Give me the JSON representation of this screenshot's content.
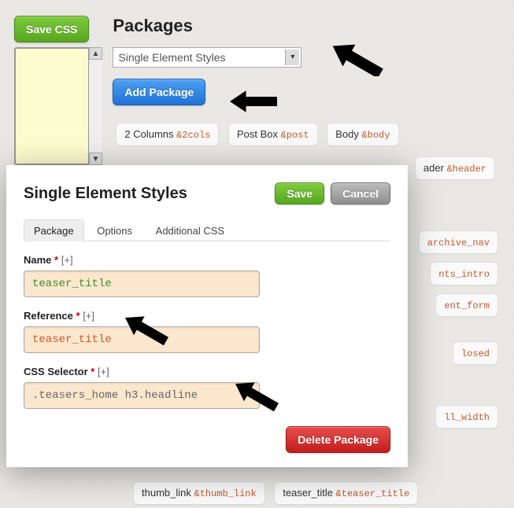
{
  "header": {
    "save_css_label": "Save CSS",
    "title": "Packages"
  },
  "package_select": {
    "selected": "Single Element Styles"
  },
  "add_package_label": "Add Package",
  "tags_row1": [
    {
      "label": "2 Columns",
      "ref": "&2cols"
    },
    {
      "label": "Post Box",
      "ref": "&post"
    },
    {
      "label": "Body",
      "ref": "&body"
    }
  ],
  "tag_header": {
    "label_suffix": "ader",
    "ref": "&header"
  },
  "right_tags": [
    {
      "ref": "archive_nav"
    },
    {
      "ref": "nts_intro"
    },
    {
      "ref": "ent_form"
    },
    {
      "ref": "losed"
    },
    {
      "ref": "ll_width"
    }
  ],
  "bottom_tags": [
    {
      "label": "thumb_link",
      "ref": "&thumb_link"
    },
    {
      "label": "teaser_title",
      "ref": "&teaser_title"
    }
  ],
  "dialog": {
    "title": "Single Element Styles",
    "save_label": "Save",
    "cancel_label": "Cancel",
    "delete_label": "Delete Package",
    "tabs": [
      {
        "label": "Package",
        "active": true
      },
      {
        "label": "Options",
        "active": false
      },
      {
        "label": "Additional CSS",
        "active": false
      }
    ],
    "fields": {
      "name": {
        "label": "Name",
        "value": "teaser_title"
      },
      "reference": {
        "label": "Reference",
        "value": "teaser_title"
      },
      "css_selector": {
        "label": "CSS Selector",
        "value": ".teasers_home h3.headline"
      }
    },
    "required_mark": "*",
    "plus_mark": "[+]"
  }
}
